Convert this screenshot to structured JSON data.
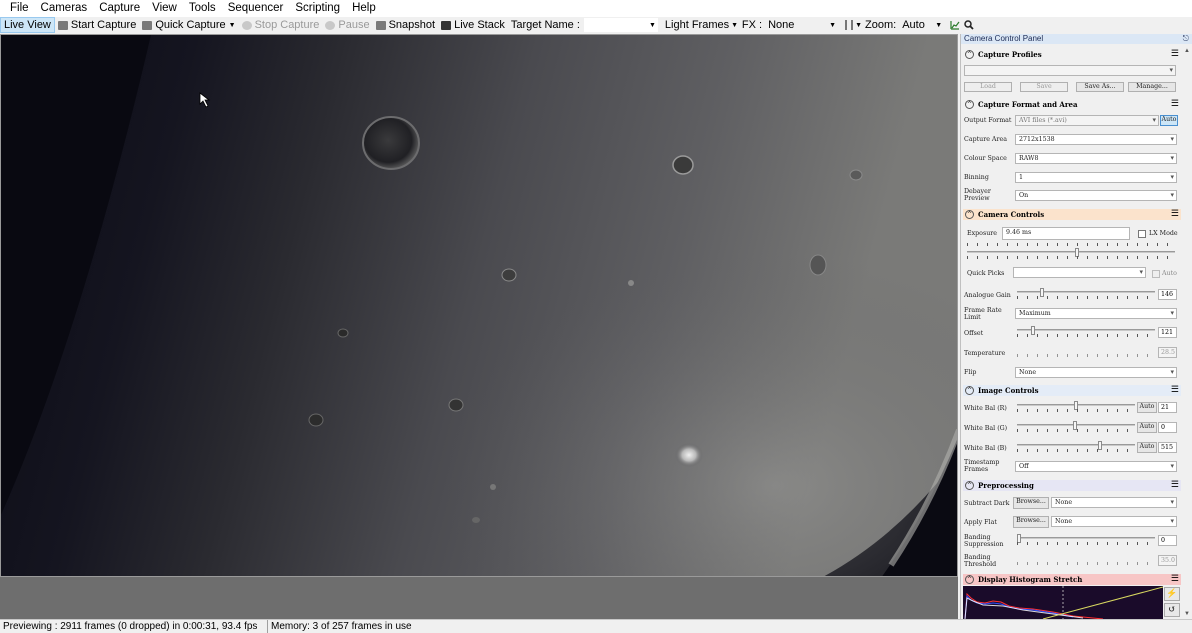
{
  "menu": [
    "File",
    "Cameras",
    "Capture",
    "View",
    "Tools",
    "Sequencer",
    "Scripting",
    "Help"
  ],
  "toolbar": {
    "live_view": "Live View",
    "start_capture": "Start Capture",
    "quick_capture": "Quick Capture",
    "stop_capture": "Stop Capture",
    "pause": "Pause",
    "snapshot": "Snapshot",
    "live_stack": "Live Stack",
    "target_name_label": "Target Name :",
    "target_name_value": "",
    "frame_type": "Light Frames",
    "fx_label": "FX :",
    "fx_value": "None",
    "zoom_label": "Zoom:",
    "zoom_value": "Auto",
    "colors": {
      "box1": "#a8a8a8",
      "box2": "#5a1010"
    }
  },
  "status": {
    "preview": "Previewing : 2911 frames (0 dropped) in 0:00:31, 93.4 fps",
    "memory": "Memory: 3 of 257 frames in use"
  },
  "panel": {
    "title": "Camera Control Panel",
    "capture_profiles": {
      "header": "Capture Profiles",
      "profile_value": "",
      "load": "Load",
      "save": "Save",
      "save_as": "Save As...",
      "manage": "Manage..."
    },
    "capture_format": {
      "header": "Capture Format and Area",
      "output_format_label": "Output Format",
      "output_format_value": "AVI files (*.avi)",
      "auto_button": "Auto",
      "capture_area_label": "Capture Area",
      "capture_area_value": "2712x1538",
      "colour_space_label": "Colour Space",
      "colour_space_value": "RAW8",
      "binning_label": "Binning",
      "binning_value": "1",
      "debayer_label": "Debayer Preview",
      "debayer_value": "On"
    },
    "camera_controls": {
      "header": "Camera Controls",
      "exposure_label": "Exposure",
      "exposure_value": "9.46 ms",
      "lx_mode": "LX Mode",
      "quick_picks_label": "Quick Picks",
      "quick_picks_value": "",
      "auto_label": "Auto",
      "analogue_gain_label": "Analogue Gain",
      "analogue_gain_value": "146",
      "frame_rate_label": "Frame Rate Limit",
      "frame_rate_value": "Maximum",
      "offset_label": "Offset",
      "offset_value": "121",
      "temperature_label": "Temperature",
      "temperature_value": "28.5",
      "flip_label": "Flip",
      "flip_value": "None"
    },
    "image_controls": {
      "header": "Image Controls",
      "wb_r_label": "White Bal (R)",
      "wb_r_value": "21",
      "wb_g_label": "White Bal (G)",
      "wb_g_value": "0",
      "wb_b_label": "White Bal (B)",
      "wb_b_value": "515",
      "auto": "Auto",
      "timestamp_label": "Timestamp Frames",
      "timestamp_value": "Off"
    },
    "preprocessing": {
      "header": "Preprocessing",
      "subtract_dark_label": "Subtract Dark",
      "apply_flat_label": "Apply Flat",
      "browse": "Browse...",
      "dark_value": "None",
      "flat_value": "None",
      "banding_suppression_label": "Banding Suppression",
      "banding_suppression_value": "0",
      "banding_threshold_label": "Banding Threshold",
      "banding_threshold_value": "35.0"
    },
    "histogram": {
      "header": "Display Histogram Stretch"
    }
  }
}
